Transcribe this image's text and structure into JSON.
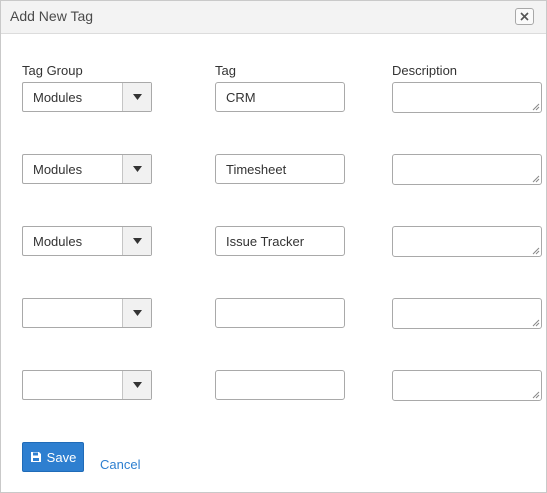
{
  "dialog": {
    "title": "Add New Tag",
    "close_icon": "close-icon"
  },
  "columns": {
    "tag_group": "Tag Group",
    "tag": "Tag",
    "description": "Description"
  },
  "rows": [
    {
      "tag_group": "Modules",
      "tag": "CRM",
      "description": ""
    },
    {
      "tag_group": "Modules",
      "tag": "Timesheet",
      "description": ""
    },
    {
      "tag_group": "Modules",
      "tag": "Issue Tracker",
      "description": ""
    },
    {
      "tag_group": "",
      "tag": "",
      "description": ""
    },
    {
      "tag_group": "",
      "tag": "",
      "description": ""
    }
  ],
  "actions": {
    "save_label": "Save",
    "save_icon": "floppy-disk-icon",
    "cancel_label": "Cancel"
  },
  "colors": {
    "primary": "#2e7fd0",
    "titlebar_bg": "#f3f3f3",
    "border": "#a9a9a9"
  }
}
